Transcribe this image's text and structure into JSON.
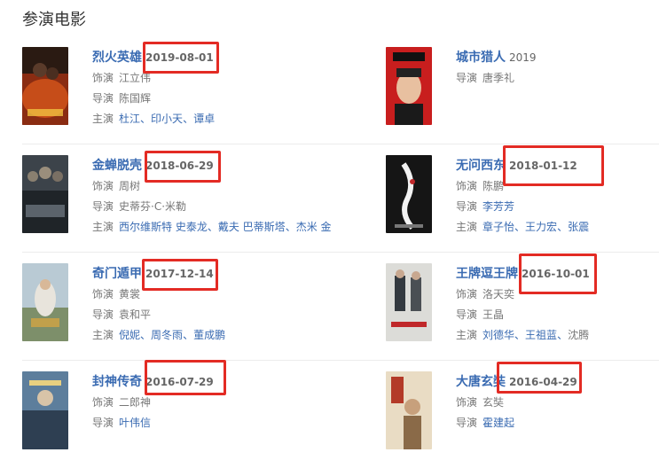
{
  "section_title": "参演电影",
  "colors": {
    "link": "#3a6bb2",
    "highlight": "#e32b24"
  },
  "films": [
    {
      "title": "烈火英雄",
      "date": "2019-08-01",
      "role_label": "饰演",
      "role": "江立伟",
      "director_label": "导演",
      "director": "陈国辉",
      "director_link": false,
      "cast_label": "主演",
      "cast": [
        "杜江",
        "印小天",
        "谭卓"
      ]
    },
    {
      "title": "城市猎人",
      "year": "2019",
      "director_label": "导演",
      "director": "唐季礼",
      "director_link": false
    },
    {
      "title": "金蝉脱壳",
      "date": "2018-06-29",
      "role_label": "饰演",
      "role": "周树",
      "director_label": "导演",
      "director": "史蒂芬·C·米勒",
      "director_link": false,
      "cast_label": "主演",
      "cast": [
        "西尔维斯特 史泰龙",
        "戴夫 巴蒂斯塔",
        "杰米 金"
      ]
    },
    {
      "title": "无问西东",
      "date": "2018-01-12",
      "role_label": "饰演",
      "role": "陈鹏",
      "director_label": "导演",
      "director": "李芳芳",
      "director_link": true,
      "cast_label": "主演",
      "cast": [
        "章子怡",
        "王力宏",
        "张震"
      ]
    },
    {
      "title": "奇门遁甲",
      "date": "2017-12-14",
      "role_label": "饰演",
      "role": "黄裳",
      "director_label": "导演",
      "director": "袁和平",
      "director_link": false,
      "cast_label": "主演",
      "cast": [
        "倪妮",
        "周冬雨",
        "董成鹏"
      ]
    },
    {
      "title": "王牌逗王牌",
      "date": "2016-10-01",
      "role_label": "饰演",
      "role": "洛天奕",
      "director_label": "导演",
      "director": "王晶",
      "director_link": false,
      "cast_label": "主演",
      "cast": [
        "刘德华",
        "王祖蓝"
      ],
      "cast_plain": "沈腾"
    },
    {
      "title": "封神传奇",
      "date": "2016-07-29",
      "role_label": "饰演",
      "role": "二郎神",
      "director_label": "导演",
      "director": "叶伟信",
      "director_link": true
    },
    {
      "title": "大唐玄奘",
      "date": "2016-04-29",
      "role_label": "饰演",
      "role": "玄奘",
      "director_label": "导演",
      "director": "霍建起",
      "director_link": true
    }
  ],
  "posters": [
    {
      "icon": "poster-red-fire"
    },
    {
      "icon": "poster-red-man"
    },
    {
      "icon": "poster-grey-group"
    },
    {
      "icon": "poster-dark-white"
    },
    {
      "icon": "poster-blue-fantasy"
    },
    {
      "icon": "poster-street-duo"
    },
    {
      "icon": "poster-blue-myth"
    },
    {
      "icon": "poster-beige-tang"
    }
  ]
}
